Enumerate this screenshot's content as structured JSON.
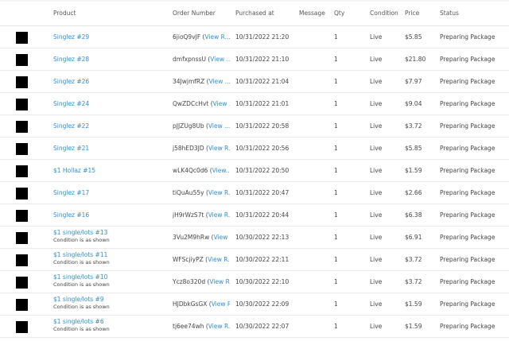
{
  "headers": {
    "product": "Product",
    "order": "Order Number",
    "purchased": "Purchased at",
    "message": "Message",
    "qty": "Qty",
    "condition": "Condition",
    "price": "Price",
    "status": "Status"
  },
  "rows": [
    {
      "product": "Singlez #29",
      "note": "",
      "order": "6jioQ9vJF",
      "view": "View R...",
      "date": "10/31/2022 21:20",
      "qty": "1",
      "condition": "Live",
      "price": "$5.85",
      "status": "Preparing Package"
    },
    {
      "product": "Singlez #28",
      "note": "",
      "order": "dmfxpnssU",
      "view": "View ...",
      "date": "10/31/2022 21:10",
      "qty": "1",
      "condition": "Live",
      "price": "$21.80",
      "status": "Preparing Package"
    },
    {
      "product": "Singlez #26",
      "note": "",
      "order": "34JwjmfRZ",
      "view": "View ...",
      "date": "10/31/2022 21:04",
      "qty": "1",
      "condition": "Live",
      "price": "$7.97",
      "status": "Preparing Package"
    },
    {
      "product": "Singlez #24",
      "note": "",
      "order": "QwZDCcHvt",
      "view": "View ...",
      "date": "10/31/2022 21:01",
      "qty": "1",
      "condition": "Live",
      "price": "$9.04",
      "status": "Preparing Package"
    },
    {
      "product": "Singlez #22",
      "note": "",
      "order": "pJJZUg8Ub",
      "view": "View ...",
      "date": "10/31/2022 20:58",
      "qty": "1",
      "condition": "Live",
      "price": "$3.72",
      "status": "Preparing Package"
    },
    {
      "product": "Singlez #21",
      "note": "",
      "order": "j58hED3JD",
      "view": "View R...",
      "date": "10/31/2022 20:56",
      "qty": "1",
      "condition": "Live",
      "price": "$5.85",
      "status": "Preparing Package"
    },
    {
      "product": "$1 Hollaz #15",
      "note": "",
      "order": "wLK4Qc0d6",
      "view": "View...",
      "date": "10/31/2022 20:50",
      "qty": "1",
      "condition": "Live",
      "price": "$1.59",
      "status": "Preparing Package"
    },
    {
      "product": "Singlez #17",
      "note": "",
      "order": "tiQuAu55y",
      "view": "View R...",
      "date": "10/31/2022 20:47",
      "qty": "1",
      "condition": "Live",
      "price": "$2.66",
      "status": "Preparing Package"
    },
    {
      "product": "Singlez #16",
      "note": "",
      "order": "jH9rWzS7t",
      "view": "View R...",
      "date": "10/31/2022 20:44",
      "qty": "1",
      "condition": "Live",
      "price": "$6.38",
      "status": "Preparing Package"
    },
    {
      "product": "$1 single/lots #13",
      "note": "Condition is as shown",
      "order": "3Vu2M9hRw",
      "view": "View R...",
      "date": "10/30/2022 22:13",
      "qty": "1",
      "condition": "Live",
      "price": "$6.91",
      "status": "Preparing Package"
    },
    {
      "product": "$1 single/lots #11",
      "note": "Condition is as shown",
      "order": "WFScjiyPZ",
      "view": "View R...",
      "date": "10/30/2022 22:11",
      "qty": "1",
      "condition": "Live",
      "price": "$3.72",
      "status": "Preparing Package"
    },
    {
      "product": "$1 single/lots #10",
      "note": "Condition is as shown",
      "order": "Ycz8o320d",
      "view": "View R...",
      "date": "10/30/2022 22:10",
      "qty": "1",
      "condition": "Live",
      "price": "$3.72",
      "status": "Preparing Package"
    },
    {
      "product": "$1 single/lots #9",
      "note": "Condition is as shown",
      "order": "HJDbkGsGX",
      "view": "View R...",
      "date": "10/30/2022 22:09",
      "qty": "1",
      "condition": "Live",
      "price": "$1.59",
      "status": "Preparing Package"
    },
    {
      "product": "$1 single/lots #6",
      "note": "Condition is as shown",
      "order": "tj6ee74wh",
      "view": "View R...",
      "date": "10/30/2022 22:07",
      "qty": "1",
      "condition": "Live",
      "price": "$1.59",
      "status": "Preparing Package"
    }
  ]
}
